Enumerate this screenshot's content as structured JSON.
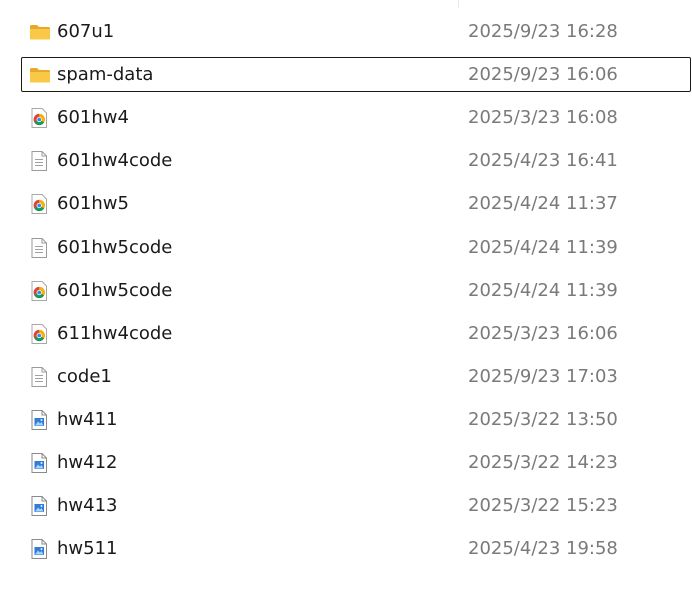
{
  "files": [
    {
      "name": "607u1",
      "modified": "2025/9/23 16:28",
      "icon": "folder-icon",
      "selected": false
    },
    {
      "name": "spam-data",
      "modified": "2025/9/23 16:06",
      "icon": "folder-icon",
      "selected": true
    },
    {
      "name": "601hw4",
      "modified": "2025/3/23 16:08",
      "icon": "chrome-html-icon",
      "selected": false
    },
    {
      "name": "601hw4code",
      "modified": "2025/4/23 16:41",
      "icon": "text-file-icon",
      "selected": false
    },
    {
      "name": "601hw5",
      "modified": "2025/4/24 11:37",
      "icon": "chrome-html-icon",
      "selected": false
    },
    {
      "name": "601hw5code",
      "modified": "2025/4/24 11:39",
      "icon": "text-file-icon",
      "selected": false
    },
    {
      "name": "601hw5code",
      "modified": "2025/4/24 11:39",
      "icon": "chrome-html-icon",
      "selected": false
    },
    {
      "name": "611hw4code",
      "modified": "2025/3/23 16:06",
      "icon": "chrome-html-icon",
      "selected": false
    },
    {
      "name": "code1",
      "modified": "2025/9/23 17:03",
      "icon": "text-file-icon",
      "selected": false
    },
    {
      "name": "hw411",
      "modified": "2025/3/22 13:50",
      "icon": "image-file-icon",
      "selected": false
    },
    {
      "name": "hw412",
      "modified": "2025/3/22 14:23",
      "icon": "image-file-icon",
      "selected": false
    },
    {
      "name": "hw413",
      "modified": "2025/3/22 15:23",
      "icon": "image-file-icon",
      "selected": false
    },
    {
      "name": "hw511",
      "modified": "2025/4/23 19:58",
      "icon": "image-file-icon",
      "selected": false
    }
  ],
  "colors": {
    "name_text": "#1a1a1a",
    "date_text": "#7a7a7a",
    "selection_border": "#1b1b1b",
    "folder": "#f8c846"
  }
}
